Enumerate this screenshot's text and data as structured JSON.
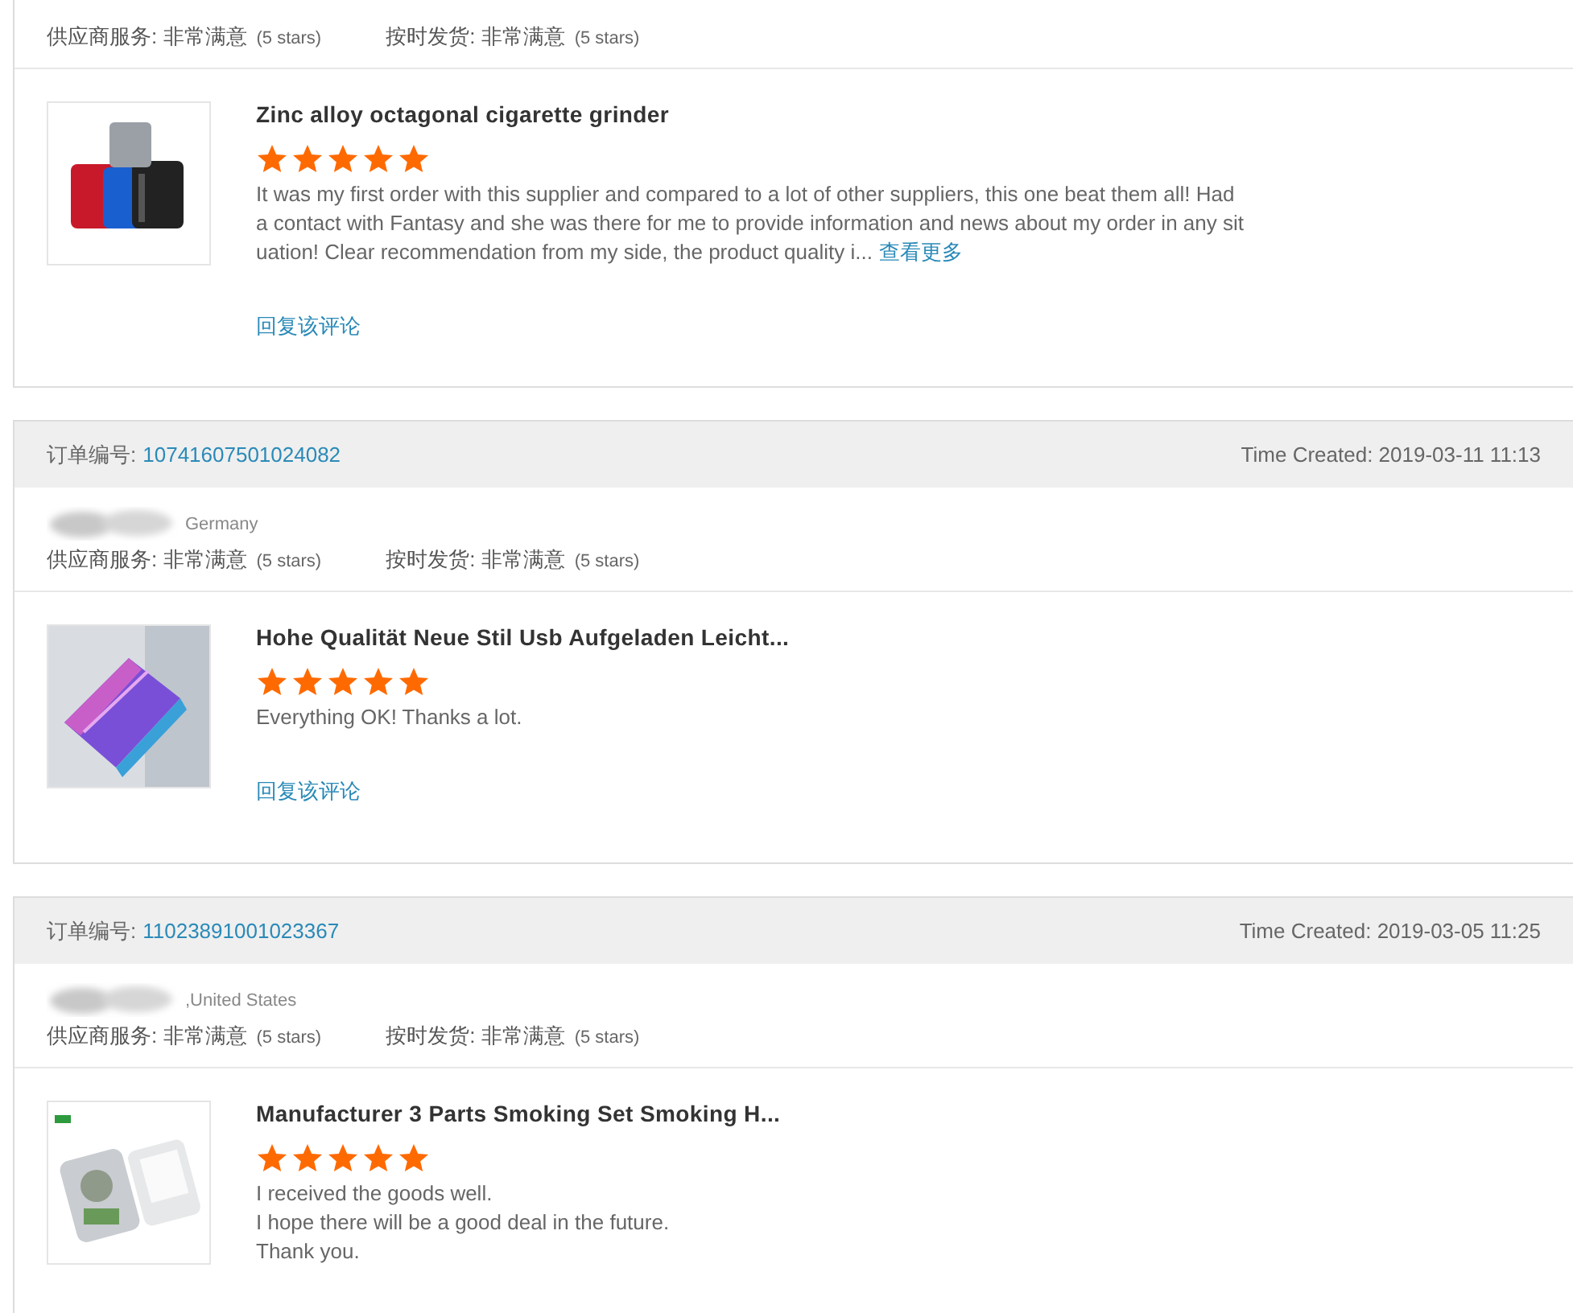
{
  "reviews": [
    {
      "ratings": [
        {
          "label": "供应商服务:",
          "value": "非常满意",
          "stars_text": "(5 stars)"
        },
        {
          "label": "按时发货:",
          "value": "非常满意",
          "stars_text": "(5 stars)"
        }
      ],
      "product": {
        "title": "Zinc alloy octagonal cigarette grinder",
        "stars": 5,
        "lines": [
          "It was my first order with this supplier and compared to a lot of other suppliers, this one beat them all! Had",
          "a contact with Fantasy and she was there for me to provide information and news about my order in any sit",
          "uation! Clear recommendation from my side, the product quality i..."
        ],
        "more": "查看更多",
        "reply": "回复该评论"
      }
    },
    {
      "order": {
        "label": "订单编号:",
        "number": "10741607501024082",
        "time": "Time Created: 2019-03-11 11:13"
      },
      "buyer": {
        "country": "Germany"
      },
      "ratings": [
        {
          "label": "供应商服务:",
          "value": "非常满意",
          "stars_text": "(5 stars)"
        },
        {
          "label": "按时发货:",
          "value": "非常满意",
          "stars_text": "(5 stars)"
        }
      ],
      "product": {
        "title": "Hohe Qualität Neue Stil Usb Aufgeladen Leicht...",
        "stars": 5,
        "lines": [
          "Everything OK! Thanks a lot."
        ],
        "reply": "回复该评论"
      }
    },
    {
      "order": {
        "label": "订单编号:",
        "number": "11023891001023367",
        "time": "Time Created: 2019-03-05 11:25"
      },
      "buyer": {
        "country": ",United States"
      },
      "ratings": [
        {
          "label": "供应商服务:",
          "value": "非常满意",
          "stars_text": "(5 stars)"
        },
        {
          "label": "按时发货:",
          "value": "非常满意",
          "stars_text": "(5 stars)"
        }
      ],
      "product": {
        "title": "Manufacturer 3 Parts Smoking Set Smoking H...",
        "stars": 5,
        "lines": [
          "I received the goods well.",
          "I hope there will be a good deal in the future.",
          "Thank you."
        ]
      }
    }
  ]
}
